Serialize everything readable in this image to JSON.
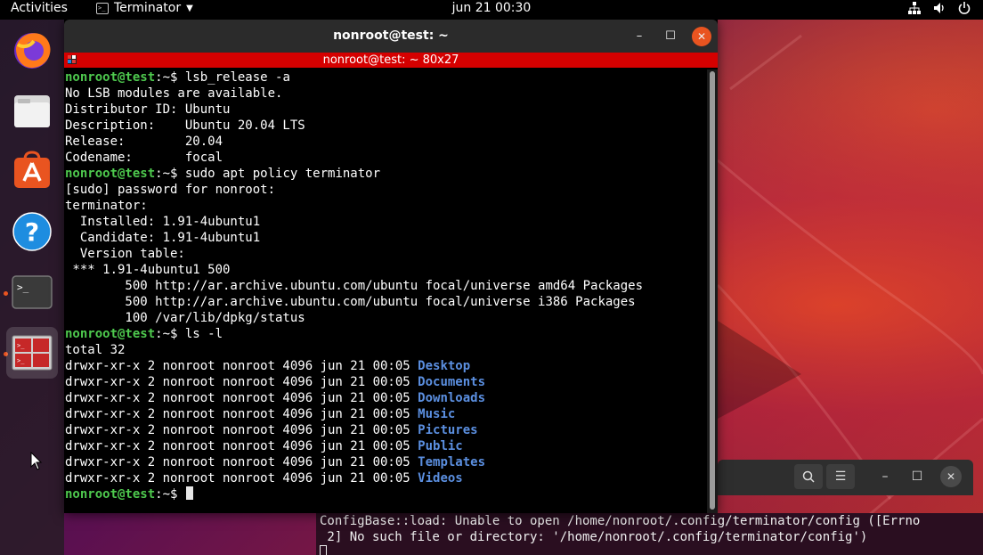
{
  "topbar": {
    "activities": "Activities",
    "app_name": "Terminator",
    "clock": "jun 21  00:30"
  },
  "dock": {
    "items": [
      {
        "icon": "firefox-icon",
        "running": false,
        "active": false
      },
      {
        "icon": "files-icon",
        "running": false,
        "active": false
      },
      {
        "icon": "software-center-icon",
        "running": false,
        "active": false
      },
      {
        "icon": "help-icon",
        "running": false,
        "active": false
      },
      {
        "icon": "terminal-icon",
        "running": true,
        "active": false
      },
      {
        "icon": "terminator-icon",
        "running": true,
        "active": true
      }
    ]
  },
  "terminal": {
    "window_title": "nonroot@test: ~",
    "header_title": "nonroot@test: ~ 80x27",
    "prompt": "nonroot@test",
    "prompt_suffix": ":~$ ",
    "lines": [
      {
        "type": "cmd",
        "text": "lsb_release -a"
      },
      {
        "type": "out",
        "text": "No LSB modules are available."
      },
      {
        "type": "out",
        "text": "Distributor ID:\tUbuntu"
      },
      {
        "type": "out",
        "text": "Description:\tUbuntu 20.04 LTS"
      },
      {
        "type": "out",
        "text": "Release:\t20.04"
      },
      {
        "type": "out",
        "text": "Codename:\tfocal"
      },
      {
        "type": "cmd",
        "text": "sudo apt policy terminator"
      },
      {
        "type": "out",
        "text": "[sudo] password for nonroot:"
      },
      {
        "type": "out",
        "text": "terminator:"
      },
      {
        "type": "out",
        "text": "  Installed: 1.91-4ubuntu1"
      },
      {
        "type": "out",
        "text": "  Candidate: 1.91-4ubuntu1"
      },
      {
        "type": "out",
        "text": "  Version table:"
      },
      {
        "type": "out",
        "text": " *** 1.91-4ubuntu1 500"
      },
      {
        "type": "out",
        "text": "        500 http://ar.archive.ubuntu.com/ubuntu focal/universe amd64 Packages"
      },
      {
        "type": "out",
        "text": "        500 http://ar.archive.ubuntu.com/ubuntu focal/universe i386 Packages"
      },
      {
        "type": "out",
        "text": "        100 /var/lib/dpkg/status"
      },
      {
        "type": "cmd",
        "text": "ls -l"
      },
      {
        "type": "out",
        "text": "total 32"
      },
      {
        "type": "ls",
        "text": "drwxr-xr-x 2 nonroot nonroot 4096 jun 21 00:05 ",
        "name": "Desktop"
      },
      {
        "type": "ls",
        "text": "drwxr-xr-x 2 nonroot nonroot 4096 jun 21 00:05 ",
        "name": "Documents"
      },
      {
        "type": "ls",
        "text": "drwxr-xr-x 2 nonroot nonroot 4096 jun 21 00:05 ",
        "name": "Downloads"
      },
      {
        "type": "ls",
        "text": "drwxr-xr-x 2 nonroot nonroot 4096 jun 21 00:05 ",
        "name": "Music"
      },
      {
        "type": "ls",
        "text": "drwxr-xr-x 2 nonroot nonroot 4096 jun 21 00:05 ",
        "name": "Pictures"
      },
      {
        "type": "ls",
        "text": "drwxr-xr-x 2 nonroot nonroot 4096 jun 21 00:05 ",
        "name": "Public"
      },
      {
        "type": "ls",
        "text": "drwxr-xr-x 2 nonroot nonroot 4096 jun 21 00:05 ",
        "name": "Templates"
      },
      {
        "type": "ls",
        "text": "drwxr-xr-x 2 nonroot nonroot 4096 jun 21 00:05 ",
        "name": "Videos"
      },
      {
        "type": "cmd",
        "text": "",
        "cursor": true
      }
    ]
  },
  "background_terminal": {
    "lines": [
      "ConfigBase::load: Unable to open /home/nonroot/.config/terminator/config ([Errno",
      " 2] No such file or directory: '/home/nonroot/.config/terminator/config')"
    ]
  },
  "colors": {
    "prompt": "#4ec94e",
    "directory": "#5b8fe0",
    "header_bar": "#d50000",
    "accent": "#e95420"
  }
}
